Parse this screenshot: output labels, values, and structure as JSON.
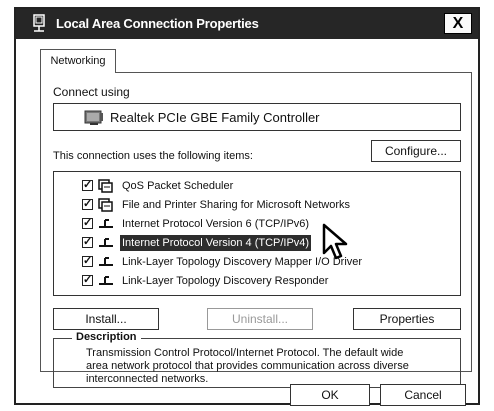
{
  "window": {
    "title": "Local Area Connection Properties",
    "close_label": "X"
  },
  "tabs": [
    {
      "label": "Networking",
      "selected": true
    }
  ],
  "connect_using": {
    "label": "Connect using",
    "adapter_name": "Realtek PCIe GBE Family Controller",
    "adapter_icon": "network-adapter-icon"
  },
  "items_section": {
    "label": "This connection uses the following items:",
    "configure_label": "Configure..."
  },
  "items": [
    {
      "label": "QoS Packet Scheduler",
      "checked": true,
      "icon": "service-icon",
      "selected": false
    },
    {
      "label": "File and Printer Sharing for Microsoft Networks",
      "checked": true,
      "icon": "service-icon",
      "selected": false
    },
    {
      "label": "Internet Protocol Version 6 (TCP/IPv6)",
      "checked": true,
      "icon": "protocol-icon",
      "selected": false
    },
    {
      "label": "Internet Protocol Version 4 (TCP/IPv4)",
      "checked": true,
      "icon": "protocol-icon",
      "selected": true
    },
    {
      "label": "Link-Layer Topology Discovery Mapper I/O Driver",
      "checked": true,
      "icon": "protocol-icon",
      "selected": false
    },
    {
      "label": "Link-Layer Topology Discovery Responder",
      "checked": true,
      "icon": "protocol-icon",
      "selected": false
    }
  ],
  "buttons": {
    "install": "Install...",
    "uninstall": "Uninstall...",
    "properties": "Properties",
    "ok": "OK",
    "cancel": "Cancel"
  },
  "description": {
    "legend": "Description",
    "text": "Transmission Control Protocol/Internet Protocol. The default wide area network protocol that provides communication across diverse interconnected networks."
  },
  "checkmark": "✓"
}
